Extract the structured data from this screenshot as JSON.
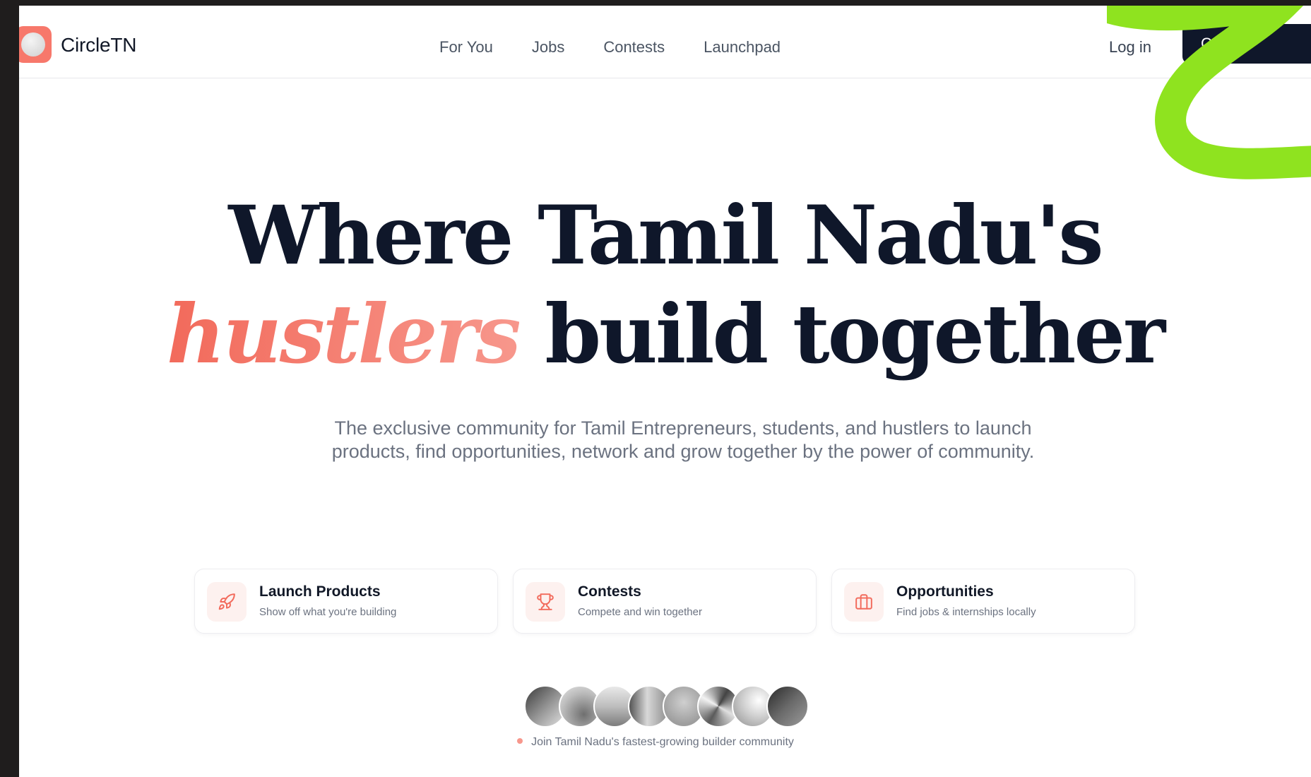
{
  "header": {
    "brand": "CircleTN",
    "nav": [
      "For You",
      "Jobs",
      "Contests",
      "Launchpad"
    ],
    "login_label": "Log in",
    "create_label": "Create"
  },
  "hero": {
    "line1": "Where Tamil Nadu's",
    "accent": "hustlers",
    "line2_rest": "build together",
    "subtitle": "The exclusive community for Tamil Entrepreneurs, students, and hustlers to launch products, find opportunities, network and grow together by the power of community."
  },
  "features": [
    {
      "title": "Launch Products",
      "desc": "Show off what you're building",
      "icon": "rocket-icon"
    },
    {
      "title": "Contests",
      "desc": "Compete and win together",
      "icon": "trophy-icon"
    },
    {
      "title": "Opportunities",
      "desc": "Find jobs & internships locally",
      "icon": "briefcase-icon"
    }
  ],
  "community": {
    "caption": "Join Tamil Nadu's fastest-growing builder community",
    "avatar_count": 8
  },
  "colors": {
    "accent": "#f26a5b",
    "dark": "#0f172a",
    "squiggle": "#8fe31f"
  }
}
